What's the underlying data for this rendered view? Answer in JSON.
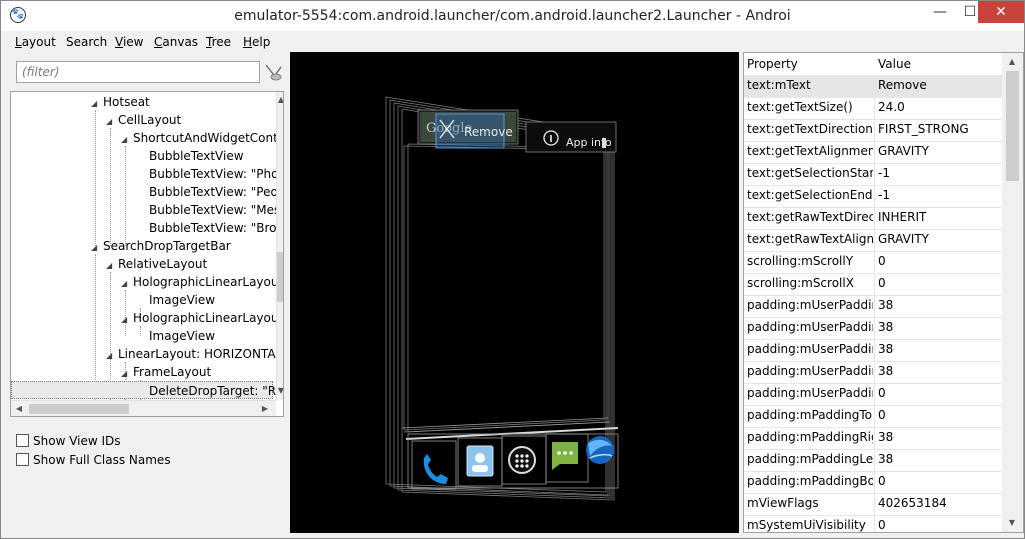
{
  "window": {
    "title": "emulator-5554:com.android.launcher/com.android.launcher2.Launcher - Androi",
    "app_icon": "paw-icon",
    "minimize_icon": "minimize-icon",
    "maximize_icon": "maximize-icon",
    "close_icon": "close-icon"
  },
  "menu": [
    {
      "label": "Layout",
      "underline": "L",
      "rest": "ayout"
    },
    {
      "label": "Search",
      "underline": "",
      "rest": "Search"
    },
    {
      "label": "View",
      "underline": "V",
      "rest": "iew"
    },
    {
      "label": "Canvas",
      "underline": "C",
      "rest": "anvas"
    },
    {
      "label": "Tree",
      "underline": "T",
      "rest": "ree"
    },
    {
      "label": "Help",
      "underline": "H",
      "rest": "elp"
    }
  ],
  "filter": {
    "placeholder": "(filter)"
  },
  "tree": {
    "items": [
      {
        "label": "Hotseat",
        "expanded": true
      },
      {
        "label": "CellLayout",
        "expanded": true
      },
      {
        "label": "ShortcutAndWidgetCont",
        "expanded": true
      },
      {
        "label": "BubbleTextView"
      },
      {
        "label": "BubbleTextView: \"Pho"
      },
      {
        "label": "BubbleTextView: \"Peo"
      },
      {
        "label": "BubbleTextView: \"Mes"
      },
      {
        "label": "BubbleTextView: \"Brov"
      },
      {
        "label": "SearchDropTargetBar",
        "expanded": true
      },
      {
        "label": "RelativeLayout",
        "expanded": true
      },
      {
        "label": "HolographicLinearLayou",
        "expanded": true
      },
      {
        "label": "ImageView"
      },
      {
        "label": "HolographicLinearLayou",
        "expanded": true
      },
      {
        "label": "ImageView"
      },
      {
        "label": "LinearLayout: HORIZONTAL",
        "expanded": true
      },
      {
        "label": "FrameLayout",
        "expanded": true
      },
      {
        "label": "DeleteDropTarget: \"Re",
        "selected": true
      }
    ]
  },
  "options": {
    "show_view_ids": "Show View IDs",
    "show_full_class_names": "Show Full Class Names"
  },
  "canvas": {
    "search_bar_text": "Google",
    "remove_label": "Remove",
    "app_info_label": "App info",
    "dock_icons": [
      "phone-icon",
      "contacts-icon",
      "all-apps-icon",
      "messaging-icon",
      "browser-icon"
    ]
  },
  "properties": {
    "header_property": "Property",
    "header_value": "Value",
    "rows": [
      {
        "k": "text:mText",
        "v": "Remove",
        "selected": true
      },
      {
        "k": "text:getTextSize()",
        "v": "24.0"
      },
      {
        "k": "text:getTextDirection()",
        "v": "FIRST_STRONG"
      },
      {
        "k": "text:getTextAlignment()",
        "v": "GRAVITY"
      },
      {
        "k": "text:getSelectionStart()",
        "v": "-1"
      },
      {
        "k": "text:getSelectionEnd()",
        "v": "-1"
      },
      {
        "k": "text:getRawTextDirectio",
        "v": "INHERIT"
      },
      {
        "k": "text:getRawTextAlignme",
        "v": "GRAVITY"
      },
      {
        "k": "scrolling:mScrollY",
        "v": "0"
      },
      {
        "k": "scrolling:mScrollX",
        "v": "0"
      },
      {
        "k": "padding:mUserPadding",
        "v": "38"
      },
      {
        "k": "padding:mUserPadding",
        "v": "38"
      },
      {
        "k": "padding:mUserPadding",
        "v": "38"
      },
      {
        "k": "padding:mUserPadding",
        "v": "38"
      },
      {
        "k": "padding:mUserPadding",
        "v": "0"
      },
      {
        "k": "padding:mPaddingTop",
        "v": "0"
      },
      {
        "k": "padding:mPaddingRigh",
        "v": "38"
      },
      {
        "k": "padding:mPaddingLeft",
        "v": "38"
      },
      {
        "k": "padding:mPaddingBott",
        "v": "0"
      },
      {
        "k": "mViewFlags",
        "v": "402653184"
      },
      {
        "k": "mSystemUiVisibility",
        "v": "0"
      }
    ]
  }
}
